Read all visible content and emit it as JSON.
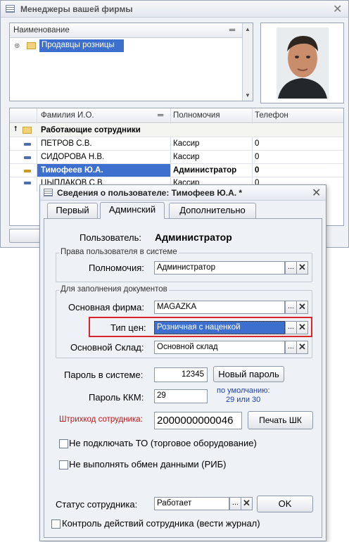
{
  "main_window": {
    "title": "Менеджеры вашей фирмы",
    "tree": {
      "header": "Наименование",
      "items": [
        {
          "label": "Продавцы розницы"
        }
      ]
    },
    "grid": {
      "columns": [
        "Фамилия И.О.",
        "Полномочия",
        "Телефон"
      ],
      "group_row": "Работающие сотрудники",
      "rows": [
        {
          "name": "ПЕТРОВ С.В.",
          "role": "Кассир",
          "phone": "0"
        },
        {
          "name": "СИДОРОВА Н.В.",
          "role": "Кассир",
          "phone": "0"
        },
        {
          "name": "Тимофеев Ю.А.",
          "role": "Администратор",
          "phone": "0"
        },
        {
          "name": "ЦЫПЛАКОВ С.В.",
          "role": "Кассир",
          "phone": "0"
        }
      ]
    }
  },
  "dialog": {
    "title": "Сведения о пользователе: Тимофеев Ю.А. *",
    "tabs": [
      {
        "label": "Первый",
        "active": false
      },
      {
        "label": "Админский",
        "active": true
      },
      {
        "label": "Дополнительно",
        "active": false
      }
    ],
    "user_label": "Пользователь:",
    "user_value": "Администратор",
    "rights_group": {
      "title": "Права пользователя в системе",
      "role_label": "Полномочия:",
      "role_value": "Администратор"
    },
    "docs_group": {
      "title": "Для заполнения документов",
      "firm_label": "Основная фирма:",
      "firm_value": "MAGAZKA",
      "price_label": "Тип цен:",
      "price_value": "Розничная с наценкой",
      "warehouse_label": "Основной Склад:",
      "warehouse_value": "Основной склад"
    },
    "password_label": "Пароль в системе:",
    "password_value": "12345",
    "new_password_button": "Новый пароль",
    "kkm_label": "Пароль ККМ:",
    "kkm_value": "29",
    "kkm_default_line1": "по умолчанию:",
    "kkm_default_line2": "29 или 30",
    "barcode_label": "Штрихкод сотрудника:",
    "barcode_value": "2000000000046",
    "print_barcode_button": "Печать ШК",
    "chk_no_equipment": "Не подключать ТО (торговое оборудование)",
    "chk_no_exchange": "Не выполнять обмен данными (РИБ)",
    "status_label": "Статус сотрудника:",
    "status_value": "Работает",
    "ok_button": "OK",
    "chk_log_actions": "Контроль действий сотрудника (вести журнал)"
  },
  "colors": {
    "highlight_frame": "#d9262b",
    "selected_fill": "#3d6fcf",
    "kkm_hint": "#1a3fb5",
    "barcode_label": "#c01818"
  },
  "buttons_glyphs": {
    "select": "...",
    "clear": "✕"
  }
}
